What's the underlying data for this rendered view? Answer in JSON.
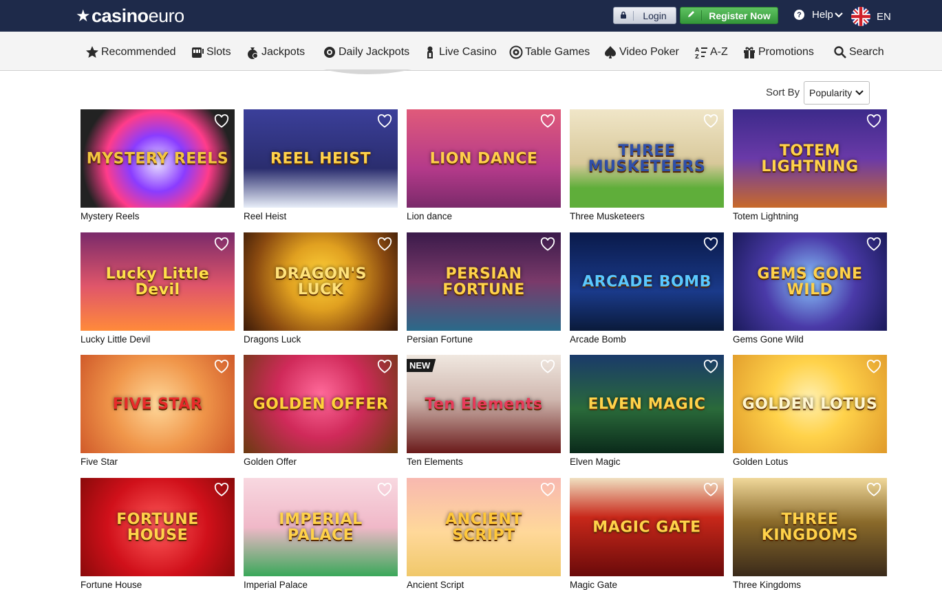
{
  "header": {
    "logo_bold": "casino",
    "logo_light": "euro",
    "login_label": "Login",
    "register_label": "Register Now",
    "help_label": "Help",
    "language": "EN"
  },
  "nav": {
    "items": [
      {
        "label": "Recommended",
        "icon": "star-icon"
      },
      {
        "label": "Slots",
        "icon": "slot-machine-icon"
      },
      {
        "label": "Jackpots",
        "icon": "money-bag-icon"
      },
      {
        "label": "Daily Jackpots",
        "icon": "gear-badge-icon"
      },
      {
        "label": "Live Casino",
        "icon": "dealer-icon"
      },
      {
        "label": "Table Games",
        "icon": "roulette-icon"
      },
      {
        "label": "Video Poker",
        "icon": "spade-icon"
      },
      {
        "label": "A-Z",
        "icon": "sort-alpha-icon"
      },
      {
        "label": "Promotions",
        "icon": "gift-icon"
      },
      {
        "label": "Search",
        "icon": "search-icon"
      }
    ]
  },
  "sort": {
    "label": "Sort By",
    "selected": "Popularity"
  },
  "games": [
    {
      "name": "Mystery Reels",
      "art_text": "MYSTERY REELS",
      "bg": "radial-gradient(circle at 50% 55%, #e8e0ff 0%, #8a3cff 30%, #ff3c8a 55%, #222 80%)",
      "fg": "#f3c640"
    },
    {
      "name": "Reel Heist",
      "art_text": "REEL HEIST",
      "bg": "linear-gradient(#3b3f9a, #2a2d6e 60%, #e8eef8 100%)",
      "fg": "#ffd24a"
    },
    {
      "name": "Lion dance",
      "art_text": "LION DANCE",
      "bg": "linear-gradient(#e05a7a, #b43a8a 60%, #7a2a6a)",
      "fg": "#ffcf4a"
    },
    {
      "name": "Three Musketeers",
      "art_text": "THREE MUSKETEERS",
      "bg": "linear-gradient(#f0e6c8, #d8c89a 55%, #5fae3a 80%)",
      "fg": "#2f4fa8"
    },
    {
      "name": "Totem Lightning",
      "art_text": "TOTEM LIGHTNING",
      "bg": "linear-gradient(#3c2a8a, #6a3aa8 50%, #c86a2a 100%)",
      "fg": "#ffd24a"
    },
    {
      "name": "Lucky Little Devil",
      "art_text": "Lucky Little Devil",
      "bg": "linear-gradient(#7a2a6a, #e0566a 55%, #ff8a3a)",
      "fg": "#ffe04a"
    },
    {
      "name": "Dragons Luck",
      "art_text": "DRAGON'S LUCK",
      "bg": "radial-gradient(circle at 50% 45%, #ffd23a 0%, #e0a020 35%, #8a4a10 70%, #3a1a08 100%)",
      "fg": "#ffe27a"
    },
    {
      "name": "Persian Fortune",
      "art_text": "PERSIAN FORTUNE",
      "bg": "linear-gradient(#3a1a4a, #7a3a6a 50%, #2a6a8a)",
      "fg": "#ffd24a"
    },
    {
      "name": "Arcade Bomb",
      "art_text": "ARCADE BOMB",
      "bg": "linear-gradient(#0a1a4a, #1a3a8a 60%, #0a1a3a)",
      "fg": "#5ac8ff"
    },
    {
      "name": "Gems Gone Wild",
      "art_text": "GEMS GONE WILD",
      "bg": "radial-gradient(circle at 50% 50%, #8ac8ff 0%, #4a3aa8 50%, #1a1a5a 100%)",
      "fg": "#ffd24a"
    },
    {
      "name": "Five Star",
      "art_text": "FIVE STAR",
      "bg": "radial-gradient(circle at 50% 50%, #ffd89a 0%, #f0964a 50%, #d05a2a 100%)",
      "fg": "#e82a2a"
    },
    {
      "name": "Golden Offer",
      "art_text": "GOLDEN OFFER",
      "bg": "radial-gradient(circle at 50% 40%, #ff6a9a 0%, #d02a5a 45%, #6a3a10 100%)",
      "fg": "#ffd23a"
    },
    {
      "name": "Ten Elements",
      "art_text": "Ten Elements",
      "bg": "linear-gradient(#f0e8e0, #d0b8b0 45%, #6a1a1a 100%)",
      "fg": "#e83a5a",
      "badge": "NEW"
    },
    {
      "name": "Elven Magic",
      "art_text": "ELVEN MAGIC",
      "bg": "linear-gradient(#1a3a6a, #2a6a3a 55%, #0a2a1a)",
      "fg": "#ffd24a"
    },
    {
      "name": "Golden Lotus",
      "art_text": "GOLDEN LOTUS",
      "bg": "radial-gradient(circle at 50% 45%, #fff0b0 0%, #ffd24a 40%, #e09a2a 100%)",
      "fg": "#fff6d0"
    },
    {
      "name": "Fortune House",
      "art_text": "FORTUNE HOUSE",
      "bg": "radial-gradient(circle at 50% 50%, #ff5a5a 0%, #d0101a 55%, #8a0a0a 100%)",
      "fg": "#ffd24a"
    },
    {
      "name": "Imperial Palace",
      "art_text": "IMPERIAL PALACE",
      "bg": "linear-gradient(#f8d8e0, #f0b8c8 50%, #3aa85a 100%)",
      "fg": "#ffd24a"
    },
    {
      "name": "Ancient Script",
      "art_text": "ANCIENT SCRIPT",
      "bg": "linear-gradient(#f8b8b0, #ffd89a 55%, #f0c86a)",
      "fg": "#ffc83a"
    },
    {
      "name": "Magic Gate",
      "art_text": "MAGIC GATE",
      "bg": "linear-gradient(#f0e0c0, #c8281a 40%, #6a0a0a 100%)",
      "fg": "#ffd24a"
    },
    {
      "name": "Three Kingdoms",
      "art_text": "THREE KINGDOMS",
      "bg": "linear-gradient(#f0d89a, #8a6a2a 45%, #3a2a1a 100%)",
      "fg": "#ffd24a"
    }
  ],
  "colors": {
    "header_bg": "#1e2a4a",
    "nav_bg": "#f4f4f4",
    "register_green": "#3fa845"
  }
}
